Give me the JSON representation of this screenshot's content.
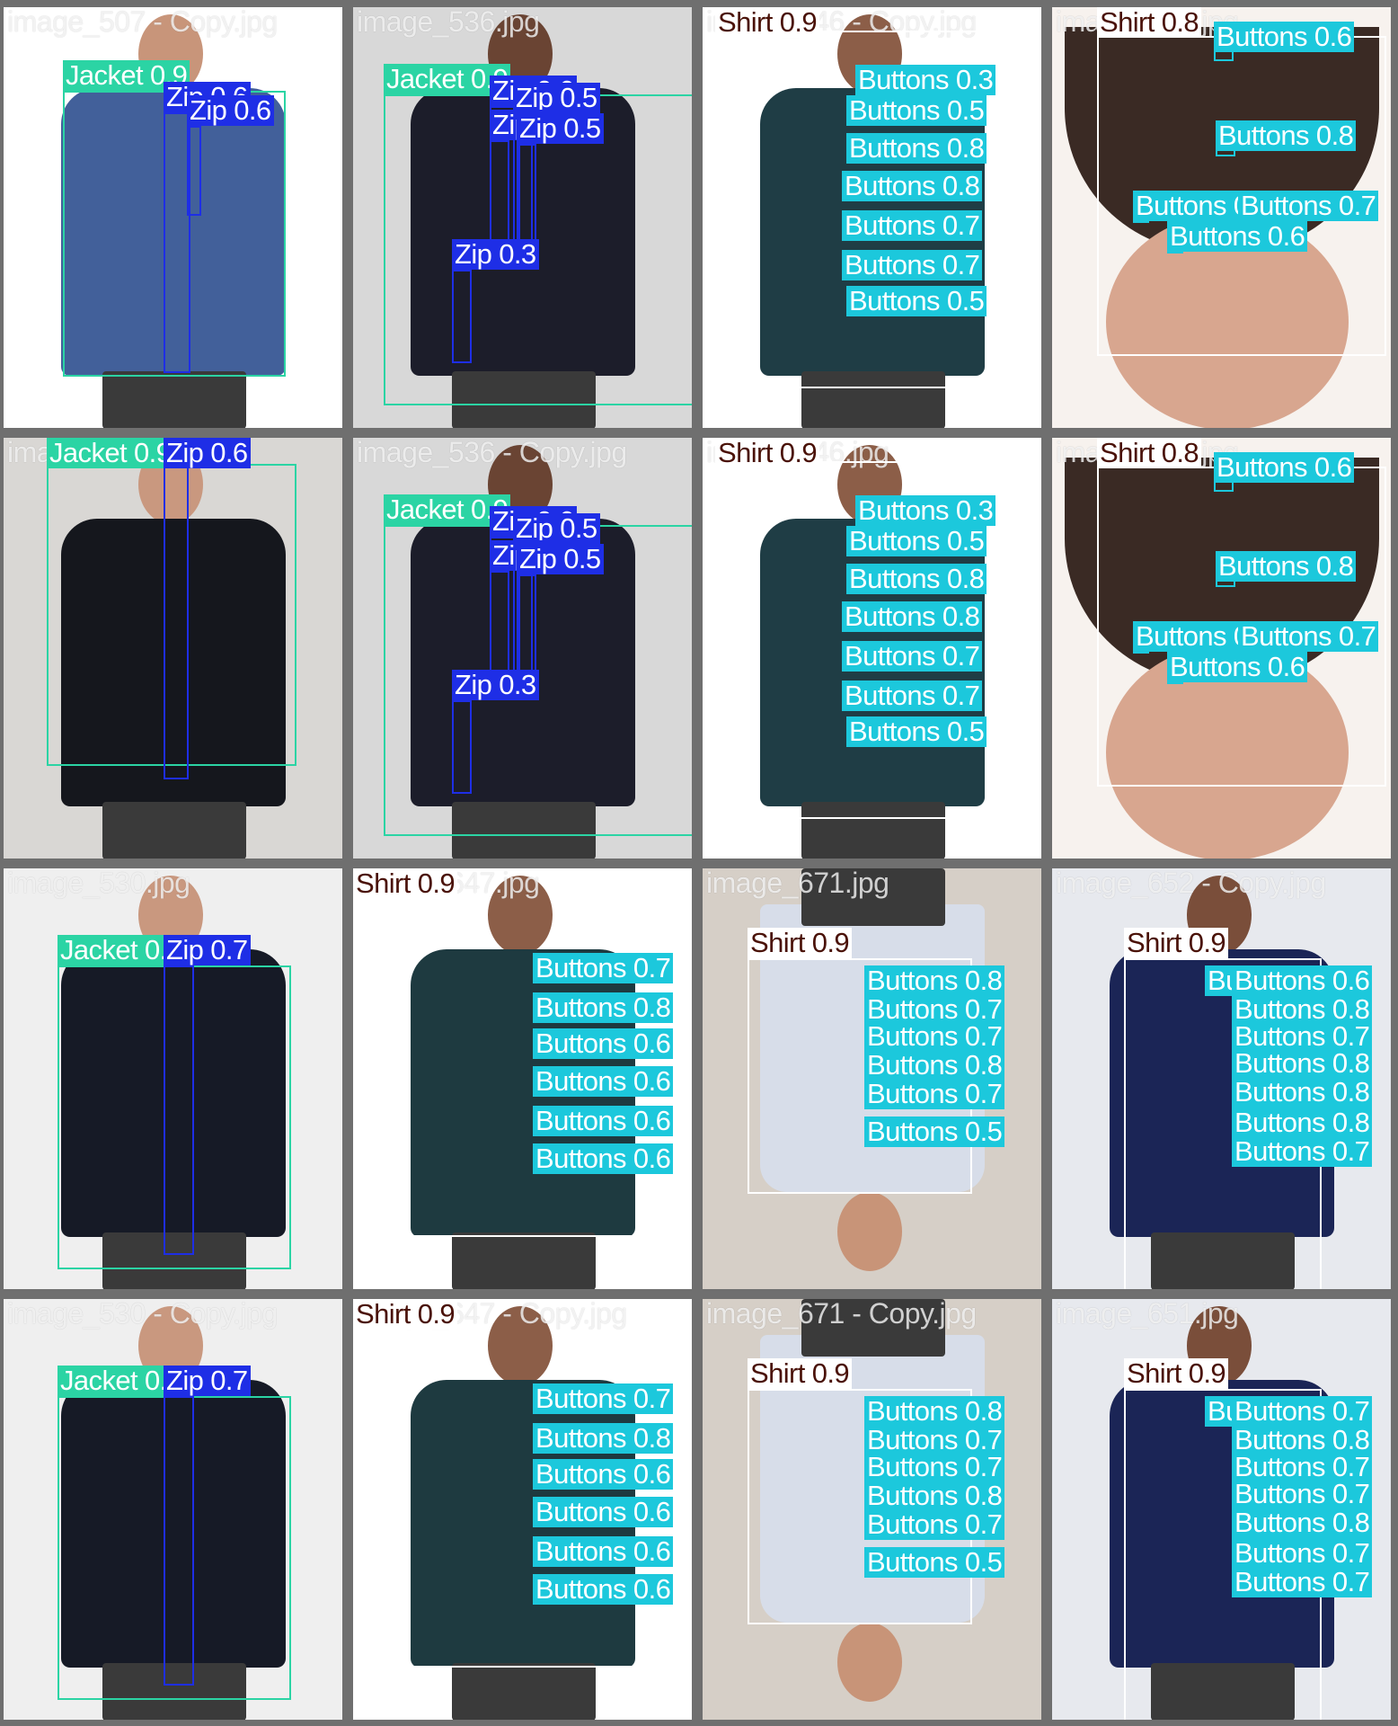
{
  "colors": {
    "background": "#6f6f6f",
    "jacket": "#2bd4a4",
    "zip": "#1e2ee6",
    "buttons": "#1cc8dc",
    "shirt": "#ffffff",
    "shirt_label": "#4a1208"
  },
  "tiles": [
    {
      "filename": "image_507 - Copy.jpg",
      "scene": {
        "bg": "#ffffff",
        "garment": "#42609a",
        "skin": "#c8957a",
        "orientation": "up"
      },
      "detections": [
        {
          "cls": "jacket",
          "label": "Jacket 0.9"
        },
        {
          "cls": "zip",
          "label": "Zip 0.6"
        },
        {
          "cls": "zip",
          "label": "Zip 0.6"
        }
      ]
    },
    {
      "filename": "image_536.jpg",
      "scene": {
        "bg": "#d8d8d8",
        "garment": "#1c1d2a",
        "skin": "#6a4433",
        "orientation": "up"
      },
      "detections": [
        {
          "cls": "jacket",
          "label": "Jacket 0.9"
        },
        {
          "cls": "zip",
          "label": "Zip 0.6"
        },
        {
          "cls": "zip",
          "label": "Zip 0.5"
        },
        {
          "cls": "zip",
          "label": "Zip 0.4"
        },
        {
          "cls": "zip",
          "label": "Zip 0.5"
        },
        {
          "cls": "zip",
          "label": "Zip 0.3"
        }
      ]
    },
    {
      "filename": "image_646 - Copy.jpg",
      "scene": {
        "bg": "#ffffff",
        "garment": "#1f3d45",
        "skin": "#8c5e48",
        "orientation": "up"
      },
      "detections": [
        {
          "cls": "shirt",
          "label": "Shirt 0.9"
        },
        {
          "cls": "buttons",
          "label": "Buttons 0.3"
        },
        {
          "cls": "buttons",
          "label": "Buttons 0.5"
        },
        {
          "cls": "buttons",
          "label": "Buttons 0.8"
        },
        {
          "cls": "buttons",
          "label": "Buttons 0.8"
        },
        {
          "cls": "buttons",
          "label": "Buttons 0.7"
        },
        {
          "cls": "buttons",
          "label": "Buttons 0.7"
        },
        {
          "cls": "buttons",
          "label": "Buttons 0.5"
        }
      ]
    },
    {
      "filename": "image_675.jpg",
      "scene": {
        "bg": "#f7f2ee",
        "garment": "#3a2a24",
        "skin": "#d8a68f",
        "orientation": "closeup"
      },
      "detections": [
        {
          "cls": "shirt",
          "label": "Shirt 0.8"
        },
        {
          "cls": "buttons",
          "label": "Buttons 0.6"
        },
        {
          "cls": "buttons",
          "label": "Buttons 0.8"
        },
        {
          "cls": "buttons",
          "label": "Buttons 0.7"
        },
        {
          "cls": "buttons",
          "label": "Buttons 0.7"
        },
        {
          "cls": "buttons",
          "label": "Buttons 0.6"
        }
      ]
    },
    {
      "filename": "image_530.jpg",
      "scene": {
        "bg": "#d9d7d4",
        "garment": "#15171d",
        "skin": "#c9987f",
        "orientation": "up"
      },
      "detections": [
        {
          "cls": "jacket",
          "label": "Jacket 0.9"
        },
        {
          "cls": "zip",
          "label": "Zip 0.6"
        }
      ]
    },
    {
      "filename": "image_536 - Copy.jpg",
      "scene": {
        "bg": "#d8d8d8",
        "garment": "#1c1d2a",
        "skin": "#6a4433",
        "orientation": "up"
      },
      "detections": [
        {
          "cls": "jacket",
          "label": "Jacket 0.9"
        },
        {
          "cls": "zip",
          "label": "Zip 0.6"
        },
        {
          "cls": "zip",
          "label": "Zip 0.5"
        },
        {
          "cls": "zip",
          "label": "Zip 0.4"
        },
        {
          "cls": "zip",
          "label": "Zip 0.5"
        },
        {
          "cls": "zip",
          "label": "Zip 0.3"
        }
      ]
    },
    {
      "filename": "image_646.jpg",
      "scene": {
        "bg": "#ffffff",
        "garment": "#1f3d45",
        "skin": "#8c5e48",
        "orientation": "up"
      },
      "detections": [
        {
          "cls": "shirt",
          "label": "Shirt 0.9"
        },
        {
          "cls": "buttons",
          "label": "Buttons 0.3"
        },
        {
          "cls": "buttons",
          "label": "Buttons 0.5"
        },
        {
          "cls": "buttons",
          "label": "Buttons 0.8"
        },
        {
          "cls": "buttons",
          "label": "Buttons 0.8"
        },
        {
          "cls": "buttons",
          "label": "Buttons 0.7"
        },
        {
          "cls": "buttons",
          "label": "Buttons 0.7"
        },
        {
          "cls": "buttons",
          "label": "Buttons 0.5"
        }
      ]
    },
    {
      "filename": "image_675.jpg",
      "scene": {
        "bg": "#f7f2ee",
        "garment": "#3a2a24",
        "skin": "#d8a68f",
        "orientation": "closeup"
      },
      "detections": [
        {
          "cls": "shirt",
          "label": "Shirt 0.8"
        },
        {
          "cls": "buttons",
          "label": "Buttons 0.6"
        },
        {
          "cls": "buttons",
          "label": "Buttons 0.8"
        },
        {
          "cls": "buttons",
          "label": "Buttons 0.7"
        },
        {
          "cls": "buttons",
          "label": "Buttons 0.7"
        },
        {
          "cls": "buttons",
          "label": "Buttons 0.6"
        }
      ]
    },
    {
      "filename": "image_530.jpg",
      "scene": {
        "bg": "#efefef",
        "garment": "#161a26",
        "skin": "#c9987f",
        "orientation": "up"
      },
      "detections": [
        {
          "cls": "jacket",
          "label": "Jacket 0.9"
        },
        {
          "cls": "zip",
          "label": "Zip 0.7"
        }
      ]
    },
    {
      "filename": "image_647.jpg",
      "scene": {
        "bg": "#ffffff",
        "garment": "#1e3a40",
        "skin": "#8c5e48",
        "orientation": "up"
      },
      "detections": [
        {
          "cls": "shirt",
          "label": "Shirt 0.9"
        },
        {
          "cls": "buttons",
          "label": "Buttons 0.7"
        },
        {
          "cls": "buttons",
          "label": "Buttons 0.8"
        },
        {
          "cls": "buttons",
          "label": "Buttons 0.6"
        },
        {
          "cls": "buttons",
          "label": "Buttons 0.6"
        },
        {
          "cls": "buttons",
          "label": "Buttons 0.6"
        },
        {
          "cls": "buttons",
          "label": "Buttons 0.6"
        }
      ]
    },
    {
      "filename": "image_671.jpg",
      "scene": {
        "bg": "#d6cfc7",
        "garment": "#d7dde9",
        "skin": "#c89478",
        "orientation": "down"
      },
      "detections": [
        {
          "cls": "shirt",
          "label": "Shirt 0.9"
        },
        {
          "cls": "buttons",
          "label": "Buttons 0.8"
        },
        {
          "cls": "buttons",
          "label": "Buttons 0.7"
        },
        {
          "cls": "buttons",
          "label": "Buttons 0.7"
        },
        {
          "cls": "buttons",
          "label": "Buttons 0.8"
        },
        {
          "cls": "buttons",
          "label": "Buttons 0.7"
        },
        {
          "cls": "buttons",
          "label": "Buttons 0.5"
        }
      ]
    },
    {
      "filename": "image_652 - Copy.jpg",
      "scene": {
        "bg": "#e7e9ee",
        "garment": "#1b2556",
        "skin": "#7a4e3a",
        "orientation": "up"
      },
      "detections": [
        {
          "cls": "shirt",
          "label": "Shirt 0.9"
        },
        {
          "cls": "buttons",
          "label": "Buttons 0.7"
        },
        {
          "cls": "buttons",
          "label": "Buttons 0.6"
        },
        {
          "cls": "buttons",
          "label": "Buttons 0.8"
        },
        {
          "cls": "buttons",
          "label": "Buttons 0.7"
        },
        {
          "cls": "buttons",
          "label": "Buttons 0.8"
        },
        {
          "cls": "buttons",
          "label": "Buttons 0.8"
        },
        {
          "cls": "buttons",
          "label": "Buttons 0.8"
        },
        {
          "cls": "buttons",
          "label": "Buttons 0.7"
        }
      ]
    },
    {
      "filename": "image_530 - Copy.jpg",
      "scene": {
        "bg": "#efefef",
        "garment": "#161a26",
        "skin": "#c9987f",
        "orientation": "up"
      },
      "detections": [
        {
          "cls": "jacket",
          "label": "Jacket 0.9"
        },
        {
          "cls": "zip",
          "label": "Zip 0.7"
        }
      ]
    },
    {
      "filename": "image_647 - Copy.jpg",
      "scene": {
        "bg": "#ffffff",
        "garment": "#1e3a40",
        "skin": "#8c5e48",
        "orientation": "up"
      },
      "detections": [
        {
          "cls": "shirt",
          "label": "Shirt 0.9"
        },
        {
          "cls": "buttons",
          "label": "Buttons 0.7"
        },
        {
          "cls": "buttons",
          "label": "Buttons 0.8"
        },
        {
          "cls": "buttons",
          "label": "Buttons 0.6"
        },
        {
          "cls": "buttons",
          "label": "Buttons 0.6"
        },
        {
          "cls": "buttons",
          "label": "Buttons 0.6"
        },
        {
          "cls": "buttons",
          "label": "Buttons 0.6"
        }
      ]
    },
    {
      "filename": "image_671 - Copy.jpg",
      "scene": {
        "bg": "#d6cfc7",
        "garment": "#d7dde9",
        "skin": "#c89478",
        "orientation": "down"
      },
      "detections": [
        {
          "cls": "shirt",
          "label": "Shirt 0.9"
        },
        {
          "cls": "buttons",
          "label": "Buttons 0.8"
        },
        {
          "cls": "buttons",
          "label": "Buttons 0.7"
        },
        {
          "cls": "buttons",
          "label": "Buttons 0.7"
        },
        {
          "cls": "buttons",
          "label": "Buttons 0.8"
        },
        {
          "cls": "buttons",
          "label": "Buttons 0.7"
        },
        {
          "cls": "buttons",
          "label": "Buttons 0.5"
        }
      ]
    },
    {
      "filename": "image_651.jpg",
      "scene": {
        "bg": "#e7e9ee",
        "garment": "#1b2556",
        "skin": "#7a4e3a",
        "orientation": "up"
      },
      "detections": [
        {
          "cls": "shirt",
          "label": "Shirt 0.9"
        },
        {
          "cls": "buttons",
          "label": "Buttons 0.7"
        },
        {
          "cls": "buttons",
          "label": "Buttons 0.7"
        },
        {
          "cls": "buttons",
          "label": "Buttons 0.8"
        },
        {
          "cls": "buttons",
          "label": "Buttons 0.7"
        },
        {
          "cls": "buttons",
          "label": "Buttons 0.7"
        },
        {
          "cls": "buttons",
          "label": "Buttons 0.8"
        },
        {
          "cls": "buttons",
          "label": "Buttons 0.7"
        },
        {
          "cls": "buttons",
          "label": "Buttons 0.7"
        }
      ]
    }
  ]
}
